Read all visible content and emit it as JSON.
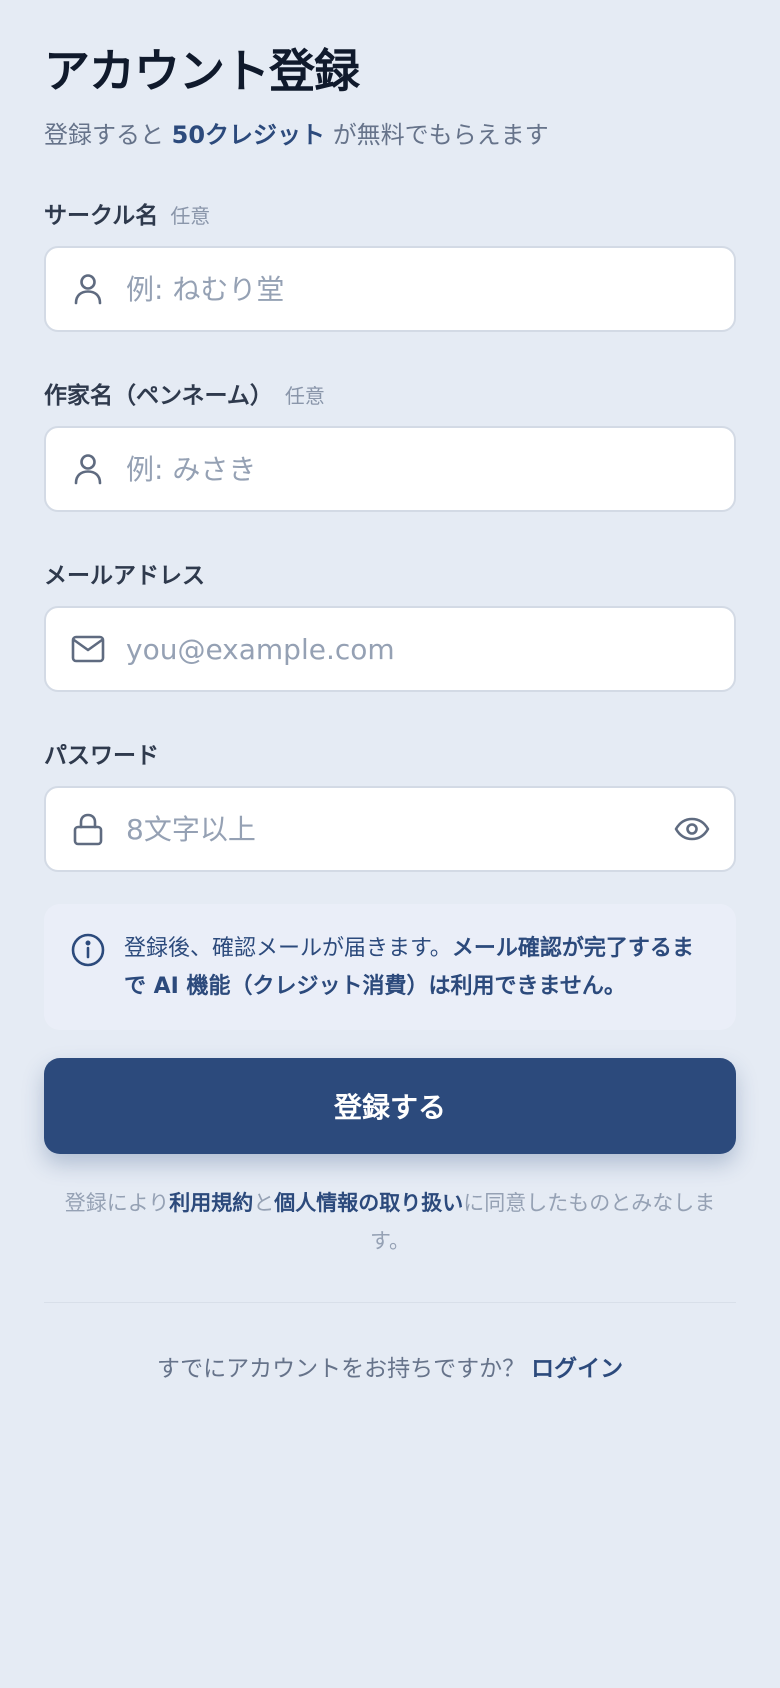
{
  "header": {
    "title": "アカウント登録",
    "subtitle_pre": "登録すると",
    "subtitle_strong": "50クレジット",
    "subtitle_post": "が無料でもらえます"
  },
  "form": {
    "circle_name": {
      "label": "サークル名",
      "optional": "任意",
      "placeholder": "例: ねむり堂",
      "icon": "user-icon"
    },
    "author_name": {
      "label": "作家名（ペンネーム）",
      "optional": "任意",
      "placeholder": "例: みさき",
      "icon": "user-icon"
    },
    "email": {
      "label": "メールアドレス",
      "placeholder": "you@example.com",
      "icon": "mail-icon"
    },
    "password": {
      "label": "パスワード",
      "placeholder": "8文字以上",
      "icon": "lock-icon",
      "toggle_icon": "eye-icon"
    }
  },
  "notice": {
    "icon": "info-icon",
    "text_plain": "登録後、確認メールが届きます。",
    "text_strong": "メール確認が完了するまで AI 機能（クレジット消費）は利用できません。"
  },
  "submit": {
    "label": "登録する"
  },
  "terms": {
    "pre": "登録により",
    "terms_link": "利用規約",
    "mid": "と",
    "privacy_link": "個人情報の取り扱い",
    "post": "に同意したものとみなします。"
  },
  "login": {
    "prompt": "すでにアカウントをお持ちですか？",
    "link": "ログイン"
  },
  "colors": {
    "background": "#e5ebf4",
    "accent": "#2c4a7c",
    "input_bg": "#ffffff",
    "notice_bg": "#eaeef8"
  }
}
